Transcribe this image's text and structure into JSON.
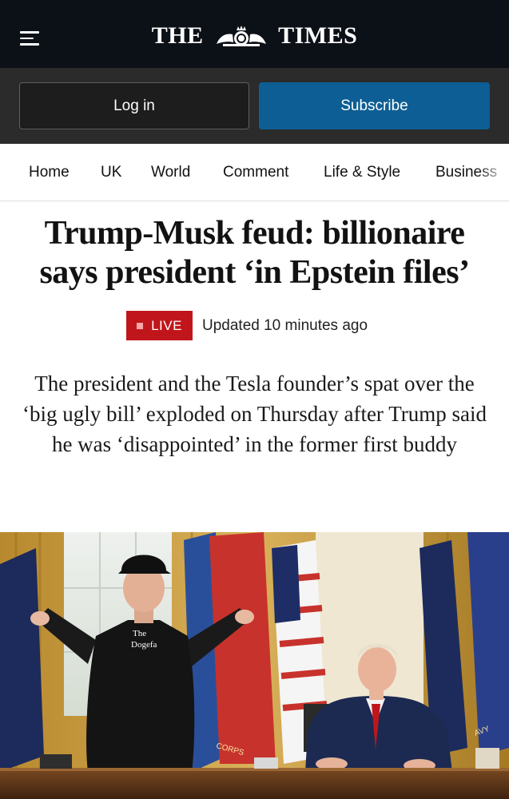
{
  "header": {
    "logo_text_left": "THE",
    "logo_text_right": "TIMES",
    "menu_icon": "hamburger-menu-icon"
  },
  "auth": {
    "login_label": "Log in",
    "subscribe_label": "Subscribe"
  },
  "nav": {
    "items": [
      "Home",
      "UK",
      "World",
      "Comment",
      "Life & Style",
      "Business"
    ]
  },
  "article": {
    "headline_line1": "Trump-Musk feud: billionaire",
    "headline_line2": "says president ‘in Epstein files’",
    "live_label": "LIVE",
    "updated": "Updated 10 minutes ago",
    "standfirst_line1": "The president and the Tesla founder’s spat over the",
    "standfirst_line2": "‘big ugly bill’ exploded on Thursday after Trump said",
    "standfirst_line3": "he was ‘disappointed’ in the former first buddy"
  },
  "hero_image": {
    "tshirt_text_1": "The",
    "tshirt_text_2": "Dogefa",
    "flag_text": "CORPS",
    "flag_text_2": "AVY"
  },
  "colors": {
    "topbar": "#0c1017",
    "authbar": "#2b2b2b",
    "subscribe": "#0d5e94",
    "live": "#c0161b"
  }
}
